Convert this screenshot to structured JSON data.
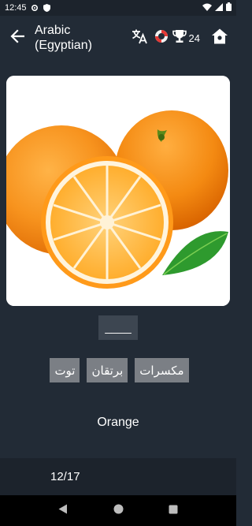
{
  "status_bar": {
    "time": "12:45"
  },
  "app_bar": {
    "title": "Arabic (Egyptian)",
    "score": "24"
  },
  "icons": {
    "back": "arrow-left-icon",
    "translate": "translate-icon",
    "help": "lifebuoy-icon",
    "trophy": "trophy-icon",
    "home": "home-icon"
  },
  "quiz": {
    "image": "orange-fruit-image",
    "answer_blank": "____",
    "choices": [
      "مكسرات",
      "برتقان",
      "توت"
    ],
    "word": "Orange",
    "progress": "12/17"
  },
  "colors": {
    "background": "#222b36",
    "bar": "#1c232c",
    "choice": "#7b7f85",
    "slot": "#3d4651"
  }
}
